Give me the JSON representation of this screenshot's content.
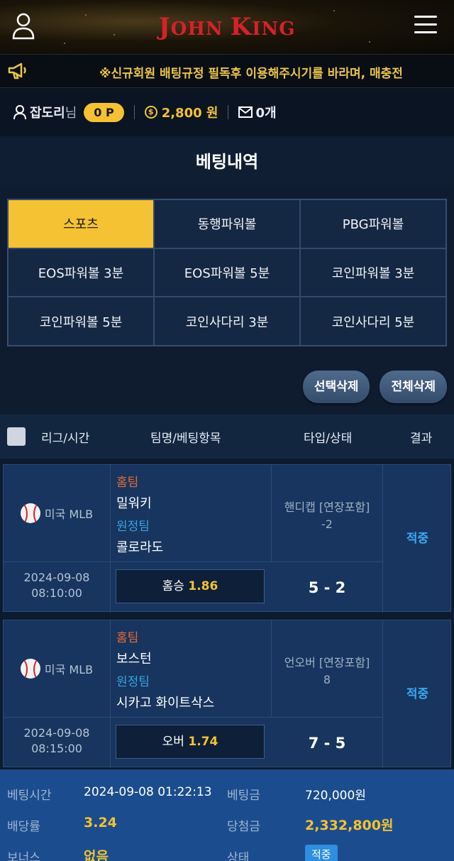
{
  "header": {
    "logo_main": "JOHN KING",
    "logo_j": "J",
    "logo_ohn": "OHN ",
    "logo_k": "K",
    "logo_ing": "ING"
  },
  "ticker": {
    "text": "※신규회원 배팅규정 필독후 이용해주시기를 바라며, 매충전"
  },
  "infobar": {
    "username": "잡도리",
    "suffix": "님",
    "points": "0 P",
    "coin_symbol": "$",
    "balance": "2,800 원",
    "messages": "0개"
  },
  "page": {
    "title": "베팅내역"
  },
  "games": [
    {
      "label": "스포츠",
      "active": true
    },
    {
      "label": "동행파워볼"
    },
    {
      "label": "PBG파워볼"
    },
    {
      "label": "EOS파워볼 3분"
    },
    {
      "label": "EOS파워볼 5분"
    },
    {
      "label": "코인파워볼 3분"
    },
    {
      "label": "코인파워볼 5분"
    },
    {
      "label": "코인사다리 3분"
    },
    {
      "label": "코인사다리 5분"
    }
  ],
  "actions": {
    "delete_selected": "선택삭제",
    "delete_all": "전체삭제"
  },
  "table": {
    "col_league": "리그/시간",
    "col_team": "팀명/베팅항목",
    "col_type": "타입/상태",
    "col_result": "결과"
  },
  "bets": [
    {
      "league": "미국 MLB",
      "date": "2024-09-08",
      "time": "08:10:00",
      "home_label": "홈팀",
      "home": "밀워키",
      "away_label": "원정팀",
      "away": "콜로라도",
      "type": "핸디캡 [연장포함]",
      "line": "-2",
      "pick": "홈승",
      "odds": "1.86",
      "score": "5 - 2",
      "result": "적중"
    },
    {
      "league": "미국 MLB",
      "date": "2024-09-08",
      "time": "08:15:00",
      "home_label": "홈팀",
      "home": "보스턴",
      "away_label": "원정팀",
      "away": "시카고 화이트삭스",
      "type": "언오버 [연장포함]",
      "line": "8",
      "pick": "오버",
      "odds": "1.74",
      "score": "7 - 5",
      "result": "적중"
    }
  ],
  "summary": {
    "bet_time_label": "베팅시간",
    "bet_time": "2024-09-08 01:22:13",
    "bet_amount_label": "베팅금",
    "bet_amount": "720,000원",
    "odds_label": "배당률",
    "odds": "3.24",
    "win_label": "당첨금",
    "win_amount": "2,332,800원",
    "bonus_label": "보너스",
    "bonus": "없음",
    "status_label": "상태",
    "status": "적중"
  },
  "colors": {
    "accent": "#f4c232",
    "logo": "#d8202a",
    "hit": "#3ba8f0"
  }
}
